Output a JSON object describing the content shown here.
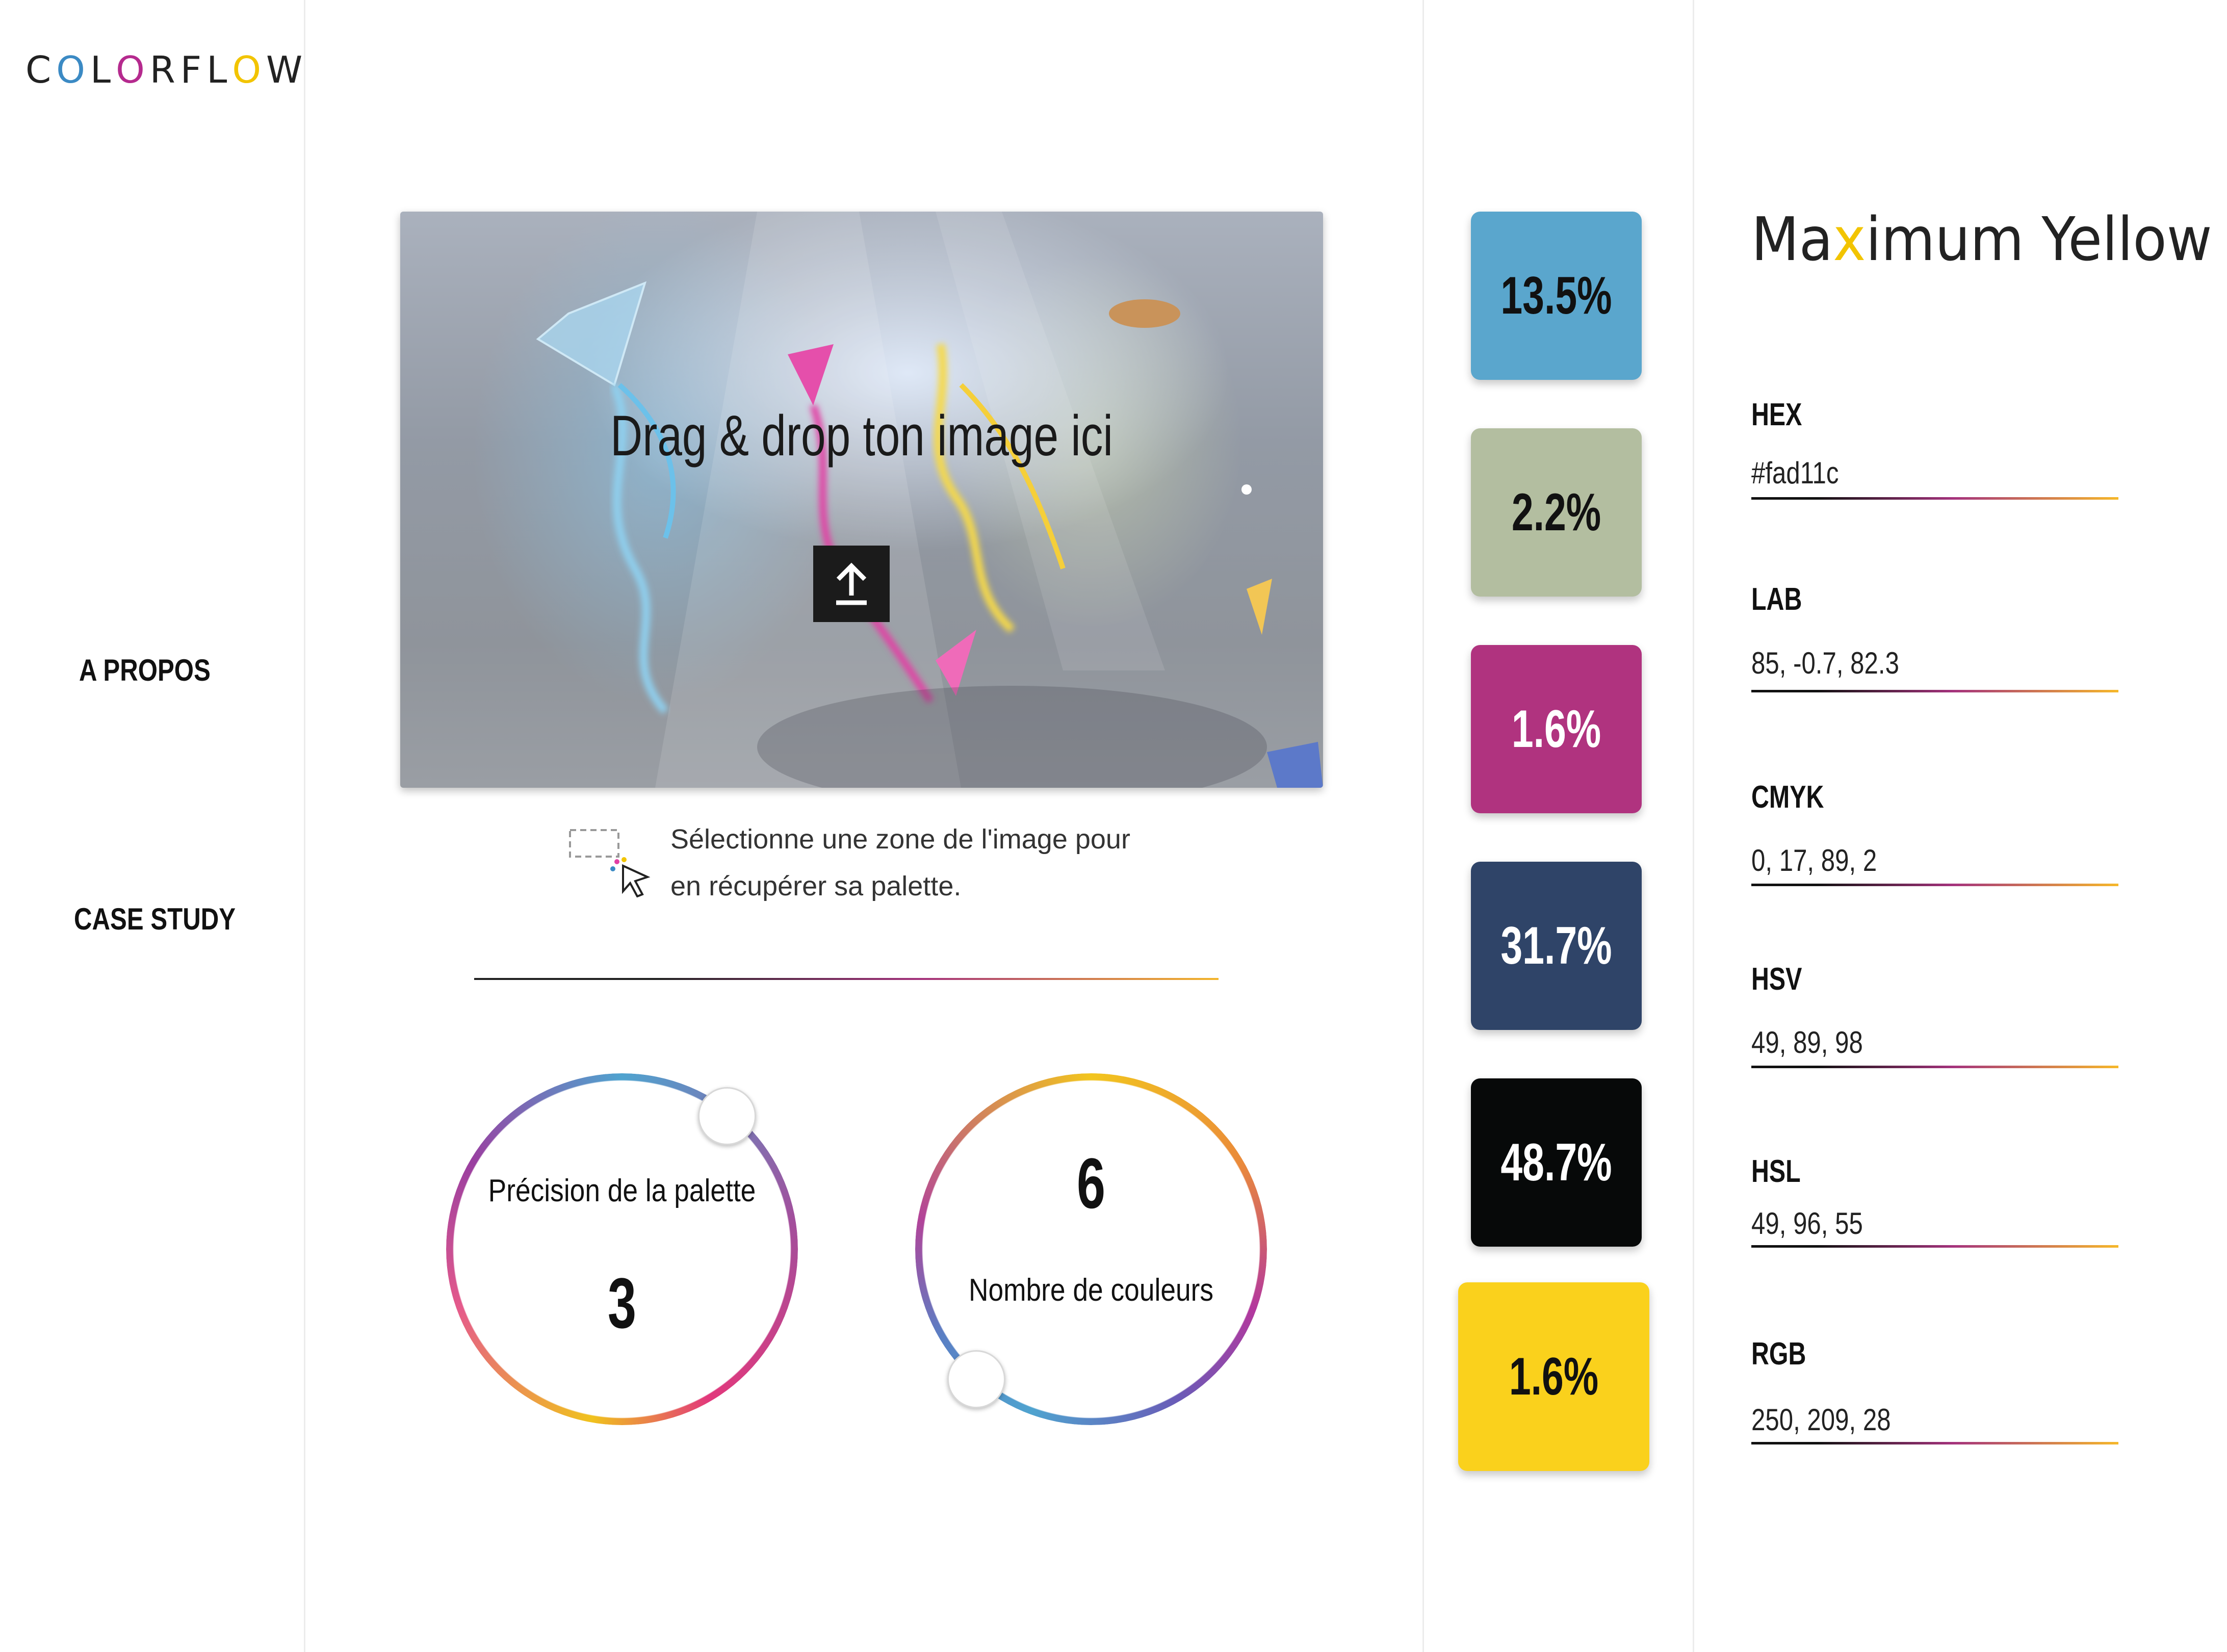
{
  "brand": {
    "logo_letters": [
      "C",
      "O",
      "L",
      "O",
      "R",
      "F",
      "L",
      "O",
      "W"
    ],
    "logo_colors": [
      "#222222",
      "#3b8ac4",
      "#222222",
      "#b52a8e",
      "#222222",
      "#222222",
      "#222222",
      "#f2c400",
      "#222222"
    ]
  },
  "nav": {
    "about": "A PROPOS",
    "case_study": "CASE STUDY"
  },
  "dropzone": {
    "title": "Drag & drop ton image ici",
    "upload_icon": "upload-arrow-icon"
  },
  "hint": {
    "line1": "Sélectionne une zone de l'image pour",
    "line2": "en récupérer sa palette."
  },
  "controls": {
    "precision": {
      "label": "Précision de la palette",
      "value": "3"
    },
    "colors_count": {
      "label": "Nombre de couleurs",
      "value": "6"
    }
  },
  "palette": [
    {
      "percent": "13.5%",
      "color": "#5aa6cd",
      "text_color": "#111111"
    },
    {
      "percent": "2.2%",
      "color": "#b3bea0",
      "text_color": "#111111"
    },
    {
      "percent": "1.6%",
      "color": "#b0337f",
      "text_color": "#ffffff"
    },
    {
      "percent": "31.7%",
      "color": "#2f4468",
      "text_color": "#ffffff"
    },
    {
      "percent": "48.7%",
      "color": "#070909",
      "text_color": "#ffffff"
    },
    {
      "percent": "1.6%",
      "color": "#fad11c",
      "text_color": "#111111"
    }
  ],
  "selected_color": {
    "name_prefix": "Ma",
    "name_accent": "x",
    "name_suffix": "imum Yellow",
    "accent_color": "#f2c400",
    "fields": [
      {
        "label": "HEX",
        "value": "#fad11c"
      },
      {
        "label": "LAB",
        "value": "85, -0.7, 82.3"
      },
      {
        "label": "CMYK",
        "value": "0, 17, 89, 2"
      },
      {
        "label": "HSV",
        "value": "49, 89, 98"
      },
      {
        "label": "HSL",
        "value": "49, 96, 55"
      },
      {
        "label": "RGB",
        "value": "250, 209, 28"
      }
    ]
  }
}
